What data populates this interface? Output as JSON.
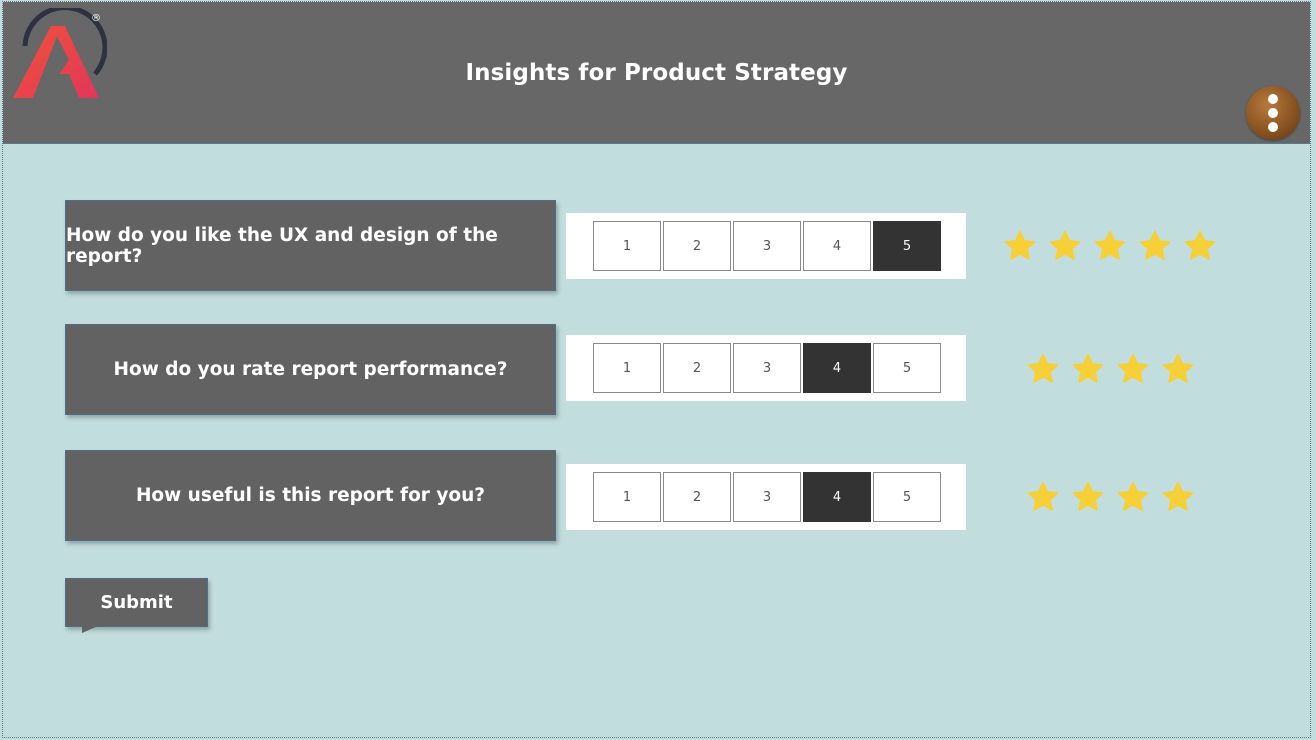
{
  "header": {
    "title": "Insights for Product Strategy",
    "logo_icon": "brand-logo-a-icon",
    "logo_mark": "®",
    "menu_icon": "more-vertical-icon",
    "background": "#676767"
  },
  "questions": [
    {
      "label": "How do you like the UX and design of the report?",
      "options": [
        "1",
        "2",
        "3",
        "4",
        "5"
      ],
      "selected": 5,
      "stars": 5
    },
    {
      "label": "How do you rate report performance?",
      "options": [
        "1",
        "2",
        "3",
        "4",
        "5"
      ],
      "selected": 4,
      "stars": 4
    },
    {
      "label": "How useful is this report for you?",
      "options": [
        "1",
        "2",
        "3",
        "4",
        "5"
      ],
      "selected": 4,
      "stars": 4
    }
  ],
  "submit_label": "Submit",
  "colors": {
    "page_bg": "#c2dddd",
    "box_bg": "#626262",
    "selected_bg": "#333333",
    "star": "#f7d038"
  }
}
